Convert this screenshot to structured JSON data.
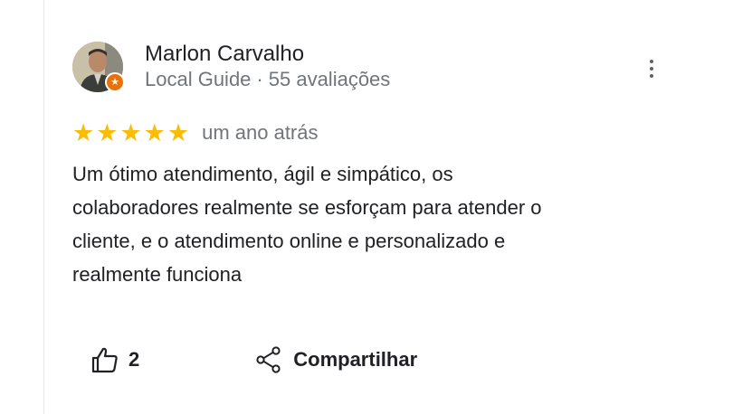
{
  "reviewer": {
    "name": "Marlon Carvalho",
    "badge": "Local Guide",
    "separator": "·",
    "review_count": "55 avaliações"
  },
  "rating": {
    "stars": 5,
    "max": 5,
    "age": "um ano atrás"
  },
  "review": {
    "text_lines": [
      "Um ótimo atendimento, ágil e simpático, os",
      "colaboradores realmente se esforçam para atender o",
      "cliente, e o atendimento online e personalizado e",
      "realmente funciona"
    ]
  },
  "actions": {
    "like_count": "2",
    "share_label": "Compartilhar"
  },
  "colors": {
    "star": "#fbbc04",
    "badge": "#e8710a",
    "secondary_text": "#70757a",
    "primary_text": "#202124"
  },
  "icons": {
    "more": "more-vert-icon",
    "like": "thumb-up-icon",
    "share": "share-icon",
    "guide_badge": "local-guide-star-icon"
  }
}
